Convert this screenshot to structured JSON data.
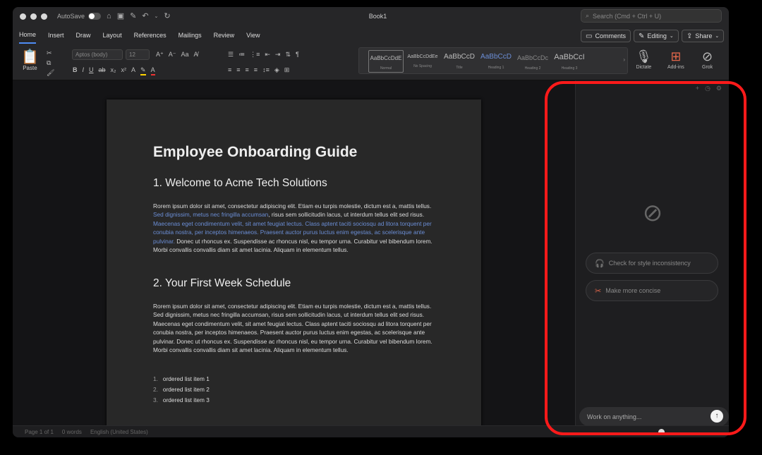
{
  "window": {
    "title": "Book1",
    "autosave_label": "AutoSave",
    "search_placeholder": "Search (Cmd + Ctrl + U)"
  },
  "menu": {
    "tabs": [
      "Home",
      "Insert",
      "Draw",
      "Layout",
      "References",
      "Mailings",
      "Review",
      "View"
    ],
    "comments_label": "Comments",
    "editing_label": "Editing",
    "share_label": "Share"
  },
  "ribbon": {
    "paste_label": "Paste",
    "font_name": "Aptos (body)",
    "font_size": "12",
    "styles": [
      {
        "preview": "AaBbCcDdE",
        "name": "Normal"
      },
      {
        "preview": "AaBbCcDdEe",
        "name": "No Spacing"
      },
      {
        "preview": "AaBbCcD",
        "name": "Title"
      },
      {
        "preview": "AaBbCcD",
        "name": "Heading 1"
      },
      {
        "preview": "AaBbCcDc",
        "name": "Heading 2"
      },
      {
        "preview": "AaBbCcI",
        "name": "Heading 3"
      }
    ],
    "dictate_label": "Dictate",
    "addins_label": "Add-ins",
    "grok_label": "Grok"
  },
  "document": {
    "title": "Employee Onboarding Guide",
    "section1_heading": "1. Welcome to Acme Tech Solutions",
    "section1_p1": "Rorem ipsum dolor sit amet, consectetur adipiscing elit. Etiam eu turpis molestie, dictum est a, mattis tellus. ",
    "section1_link1": "Sed dignissim, metus nec fringilla accumsan",
    "section1_p2": ", risus sem sollicitudin lacus, ut interdum tellus elit sed risus. ",
    "section1_link2": "Maecenas eget condimentum velit, sit amet feugiat lectus. Class aptent taciti sociosqu ad litora torquent per conubia nostra, per inceptos himenaeos. Praesent auctor purus luctus enim egestas, ac scelerisque ante pulvinar.",
    "section1_p3": " Donec ut rhoncus ex. Suspendisse ac rhoncus nisl, eu tempor urna. Curabitur vel bibendum lorem. Morbi convallis convallis diam sit amet lacinia. Aliquam in elementum tellus.",
    "section2_heading": "2. Your First Week Schedule",
    "section2_p": "Rorem ipsum dolor sit amet, consectetur adipiscing elit. Etiam eu turpis molestie, dictum est a, mattis tellus. Sed dignissim, metus nec fringilla accumsan, risus sem sollicitudin lacus, ut interdum tellus elit sed risus. Maecenas eget condimentum velit, sit amet feugiat lectus. Class aptent taciti sociosqu ad litora torquent per conubia nostra, per inceptos himenaeos. Praesent auctor purus luctus enim egestas, ac scelerisque ante pulvinar. Donec ut rhoncus ex. Suspendisse ac rhoncus nisl, eu tempor urna. Curabitur vel bibendum lorem. Morbi convallis convallis diam sit amet lacinia. Aliquam in elementum tellus.",
    "list": [
      {
        "num": "1.",
        "text": "ordered list item 1"
      },
      {
        "num": "2.",
        "text": "ordered list item 2"
      },
      {
        "num": "3.",
        "text": "ordered list item 3"
      }
    ]
  },
  "panel": {
    "suggestion1": "Check for style inconsistency",
    "suggestion2": "Make more concise",
    "input_placeholder": "Work on anything..."
  },
  "status": {
    "page": "Page 1 of 1",
    "words": "0 words",
    "language": "English (United States)"
  },
  "colors": {
    "highlight": "#ff1a1a",
    "link": "#6b8ed6",
    "accent": "#4e8cf5"
  }
}
